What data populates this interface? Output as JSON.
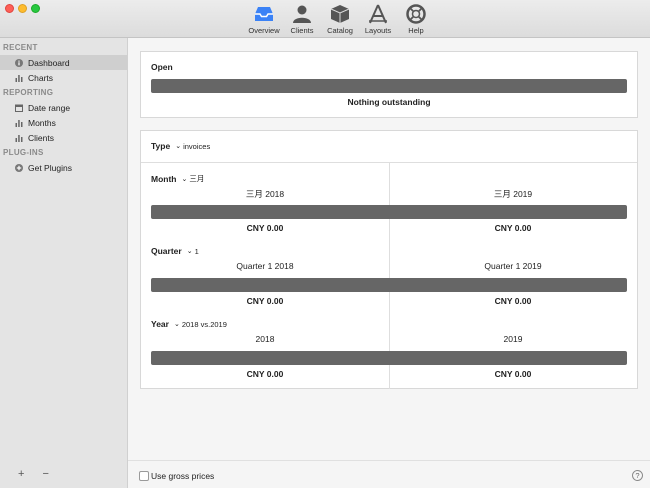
{
  "toolbar": {
    "items": [
      {
        "label": "Overview",
        "icon": "inbox-icon"
      },
      {
        "label": "Clients",
        "icon": "person-icon"
      },
      {
        "label": "Catalog",
        "icon": "box-icon"
      },
      {
        "label": "Layouts",
        "icon": "pencil-ruler-icon"
      },
      {
        "label": "Help",
        "icon": "lifebuoy-icon"
      }
    ],
    "accent_color": "#3b82f6"
  },
  "sidebar": {
    "sections": [
      {
        "heading": "RECENT",
        "items": [
          {
            "label": "Dashboard",
            "icon": "info-icon",
            "selected": true
          },
          {
            "label": "Charts",
            "icon": "bar-chart-icon",
            "selected": false
          }
        ]
      },
      {
        "heading": "REPORTING",
        "items": [
          {
            "label": "Date range",
            "icon": "calendar-icon",
            "selected": false
          },
          {
            "label": "Months",
            "icon": "bar-chart-icon",
            "selected": false
          },
          {
            "label": "Clients",
            "icon": "bar-chart-icon",
            "selected": false
          }
        ]
      },
      {
        "heading": "PLUG-INS",
        "items": [
          {
            "label": "Get Plugins",
            "icon": "plus-circle-icon",
            "selected": false
          }
        ]
      }
    ],
    "footer": {
      "add": "+",
      "remove": "−"
    }
  },
  "open": {
    "title": "Open",
    "status": "Nothing outstanding"
  },
  "type_card": {
    "type_label": "Type",
    "type_value": "invoices",
    "rows": [
      {
        "label": "Month",
        "selector": "三月",
        "left_period": "三月 2018",
        "right_period": "三月 2019",
        "left_amount": "CNY 0.00",
        "right_amount": "CNY 0.00"
      },
      {
        "label": "Quarter",
        "selector": "1",
        "left_period": "Quarter 1 2018",
        "right_period": "Quarter 1 2019",
        "left_amount": "CNY 0.00",
        "right_amount": "CNY 0.00"
      },
      {
        "label": "Year",
        "selector": "2018 vs.2019",
        "left_period": "2018",
        "right_period": "2019",
        "left_amount": "CNY 0.00",
        "right_amount": "CNY 0.00"
      }
    ]
  },
  "bottom": {
    "gross_prices_label": "Use gross prices",
    "help": "?"
  }
}
